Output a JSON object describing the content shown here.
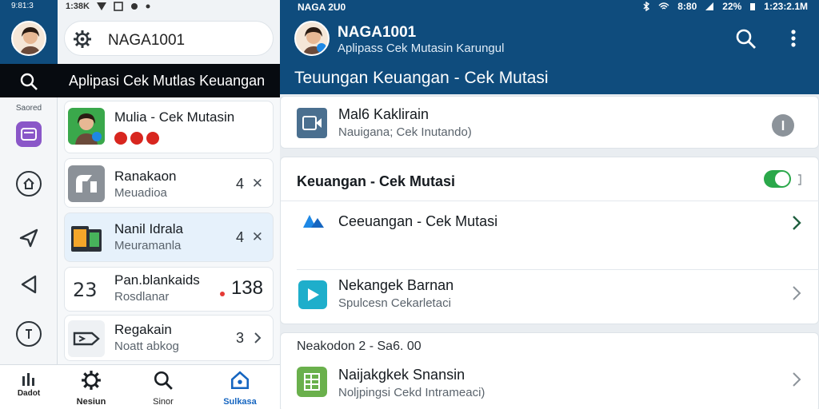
{
  "colors": {
    "appbar": "#0f4c7d",
    "accent": "#1565c0",
    "toggle_on": "#2aa84a",
    "dark_band": "#070b10"
  },
  "rail": {
    "status_text": "9:81:3",
    "search_icon": "search-icon",
    "label": "Saored",
    "bottom_label": "Dadot"
  },
  "middle": {
    "status_text": "1:38K",
    "search_value": "NAGA1001",
    "band_title": "Aplipasi Cek Mutlas Keuangan",
    "items": [
      {
        "title": "Mulia - Cek Mutasin",
        "sub": "",
        "count": "",
        "icon": "avatar"
      },
      {
        "title": "Ranakaon",
        "sub": "Meuadioa",
        "count": "4",
        "icon": "tools-icon"
      },
      {
        "title": "Nanil Idrala",
        "sub": "Meuramanla",
        "count": "4",
        "icon": "phone-icon"
      },
      {
        "title": "Pan.blankaids",
        "sub": "Rosdlanar",
        "count": "138",
        "left_num": "23",
        "icon": "numbers-icon"
      },
      {
        "title": "Regakain",
        "sub": "Noatt abkog",
        "count": "3",
        "icon": "tag-icon"
      }
    ],
    "tabs": [
      {
        "label": "Nesiun",
        "icon": "gear-icon"
      },
      {
        "label": "Sinor",
        "icon": "search-icon"
      },
      {
        "label": "Sulkasa",
        "icon": "home-icon"
      }
    ]
  },
  "right": {
    "status_left": "NAGA 2U0",
    "status_right": [
      "8:80",
      "22%",
      "1:23:2.1M"
    ],
    "account_name": "NAGA1001",
    "account_sub": "Aplipass Cek Mutasin Karungul",
    "heading": "Teuungan Keuangan - Cek Mutasi",
    "row1": {
      "title": "Mal6 Kaklirain",
      "sub": "Nauigana; Cek Inutando)"
    },
    "section2": {
      "title": "Keuangan - Cek Mutasi",
      "toggle": "on",
      "row_a": {
        "title": "Ceeuangan - Cek Mutasi"
      },
      "row_b": {
        "title": "Nekangek Barnan",
        "sub": "Spulcesn Cekarletaci"
      }
    },
    "section3": {
      "header": "Neakodon 2 - Sa6. 00",
      "row": {
        "title": "Naijakgkek Snansin",
        "sub": "Noljpingsi Cekd Intrameaci)"
      }
    }
  }
}
